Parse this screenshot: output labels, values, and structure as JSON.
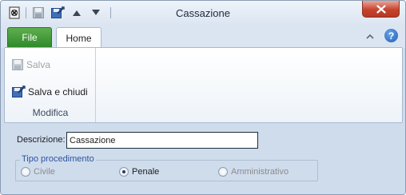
{
  "window": {
    "title": "Cassazione"
  },
  "quick_access": {
    "icons": [
      "app-icon",
      "save-icon",
      "save-close-icon",
      "arrow-up-icon",
      "arrow-down-icon"
    ]
  },
  "tabs": {
    "file_label": "File",
    "home_label": "Home"
  },
  "ribbon": {
    "save_label": "Salva",
    "save_close_label": "Salva e chiudi",
    "group_label": "Modifica"
  },
  "form": {
    "description_label": "Descrizione:",
    "description_value": "Cassazione",
    "procedure_group_label": "Tipo procedimento",
    "options": [
      {
        "label": "Civile",
        "selected": false
      },
      {
        "label": "Penale",
        "selected": true
      },
      {
        "label": "Amministrativo",
        "selected": false
      }
    ]
  },
  "colors": {
    "file_tab": "#2f8a2a",
    "close_button": "#c7432e",
    "form_background": "#cfdcec",
    "legend_text": "#2c55a0"
  }
}
